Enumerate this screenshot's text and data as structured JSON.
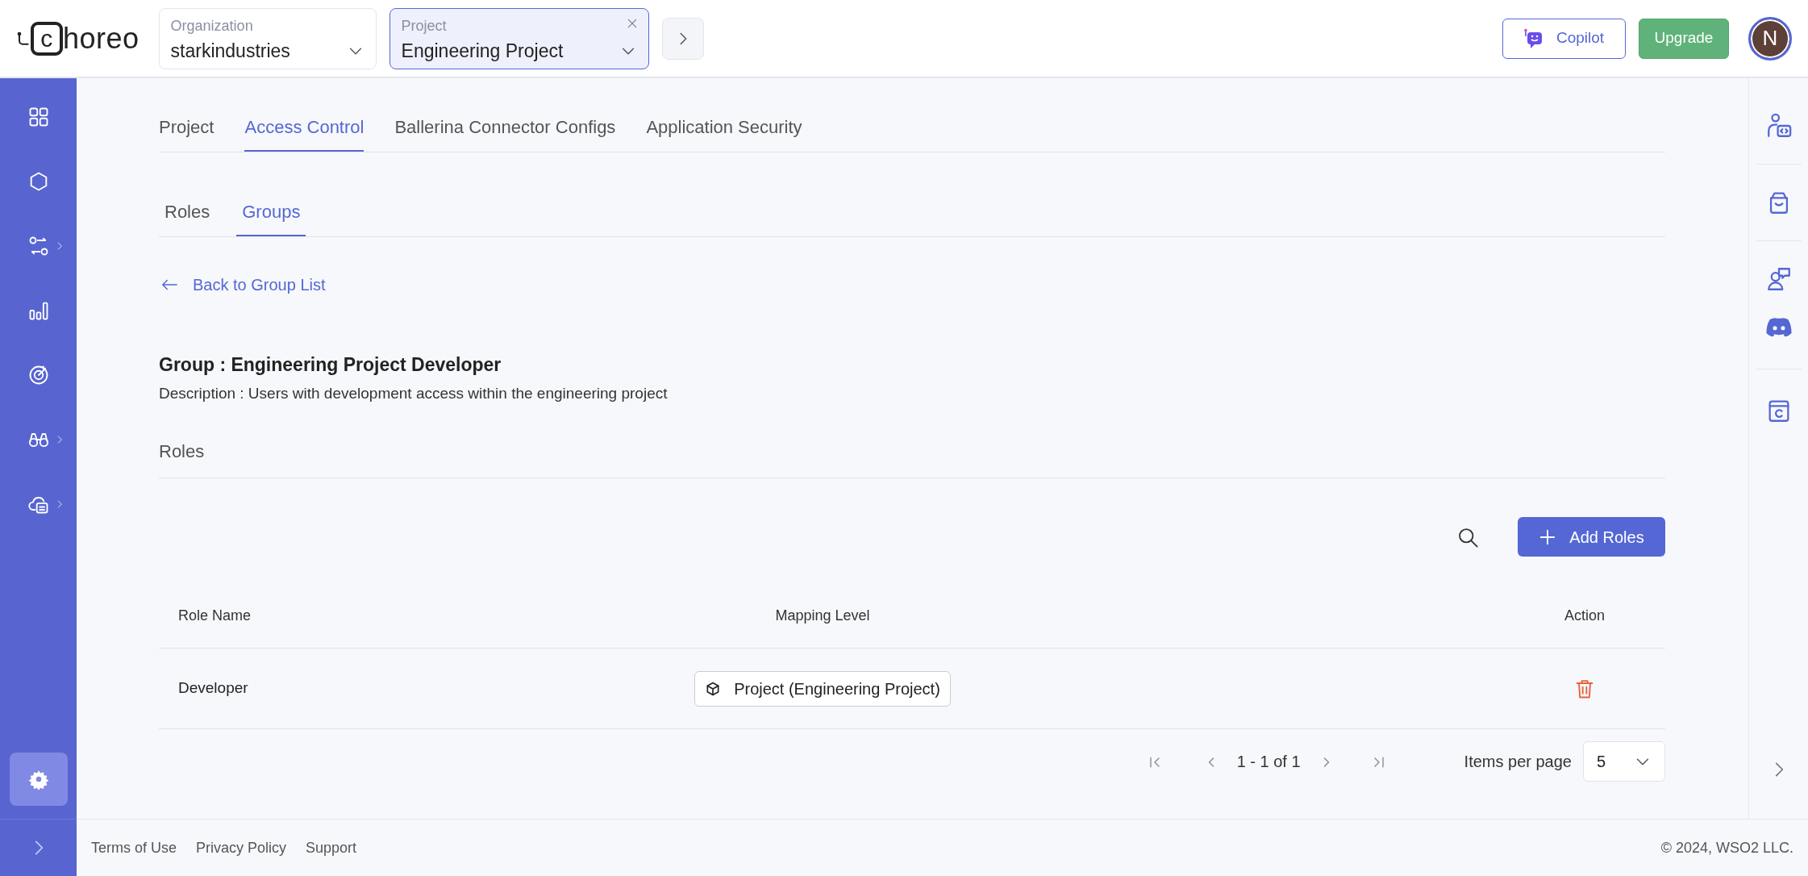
{
  "header": {
    "logo": {
      "mark": "c",
      "text": "horeo"
    },
    "selectors": [
      {
        "label": "Organization",
        "value": "starkindustries",
        "selected": false,
        "clearable": false
      },
      {
        "label": "Project",
        "value": "Engineering Project",
        "selected": true,
        "clearable": true
      }
    ],
    "copilot": "Copilot",
    "upgrade": "Upgrade",
    "avatar": "N"
  },
  "left_nav": [
    {
      "kind": "grid",
      "expandable": false,
      "selected": false
    },
    {
      "kind": "hexagon",
      "expandable": false,
      "selected": false
    },
    {
      "kind": "flow",
      "expandable": true,
      "selected": false
    },
    {
      "kind": "bars",
      "expandable": false,
      "selected": false
    },
    {
      "kind": "target",
      "expandable": false,
      "selected": false
    },
    {
      "kind": "binoculars",
      "expandable": true,
      "selected": false
    },
    {
      "kind": "cloud",
      "expandable": true,
      "selected": false
    },
    {
      "kind": "gear",
      "expandable": false,
      "selected": true
    }
  ],
  "tabs": [
    {
      "label": "Project",
      "selected": false
    },
    {
      "label": "Access Control",
      "selected": true
    },
    {
      "label": "Ballerina Connector Configs",
      "selected": false
    },
    {
      "label": "Application Security",
      "selected": false
    }
  ],
  "subtabs": [
    {
      "label": "Roles",
      "selected": false
    },
    {
      "label": "Groups",
      "selected": true
    }
  ],
  "back_link": "Back to Group List",
  "group": {
    "title": "Group : Engineering Project Developer",
    "description": "Description : Users with development access within the engineering project"
  },
  "section_title": "Roles",
  "add_button": "Add Roles",
  "table": {
    "columns": [
      "Role Name",
      "Mapping Level",
      "Action"
    ],
    "rows": [
      {
        "role": "Developer",
        "mapping": "Project (Engineering Project)"
      }
    ]
  },
  "pagination": {
    "range": "1 - 1 of 1",
    "items_per_page_label": "Items per page",
    "items_per_page": "5"
  },
  "footer": {
    "links": [
      "Terms of Use",
      "Privacy Policy",
      "Support"
    ],
    "copyright": "© 2024, WSO2 LLC."
  }
}
